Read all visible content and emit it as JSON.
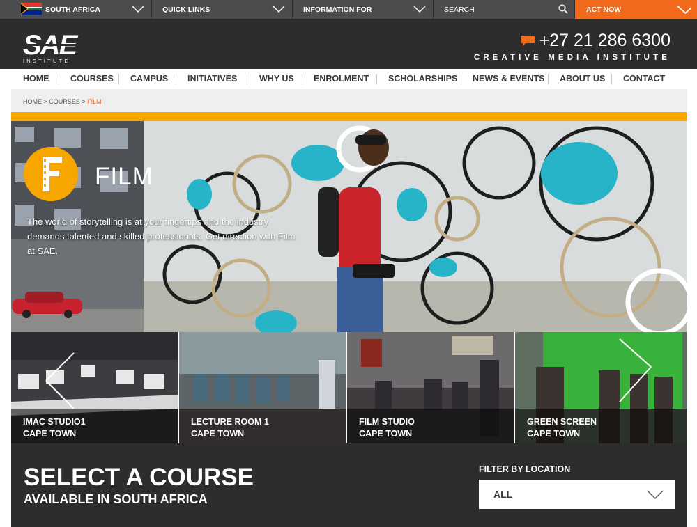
{
  "topbar": {
    "country": "SOUTH AFRICA",
    "quick_links": "QUICK LINKS",
    "information_for": "INFORMATION FOR",
    "search_placeholder": "SEARCH",
    "act_now": "ACT NOW"
  },
  "header": {
    "logo_text": "SAE",
    "logo_sub": "INSTITUTE",
    "phone": "+27 21 286 6300",
    "tagline": "CREATIVE MEDIA INSTITUTE"
  },
  "nav": {
    "items": [
      "HOME",
      "COURSES",
      "CAMPUS",
      "INITIATIVES",
      "WHY US",
      "ENROLMENT",
      "SCHOLARSHIPS",
      "NEWS & EVENTS",
      "ABOUT US",
      "CONTACT"
    ]
  },
  "breadcrumb": {
    "home": "HOME",
    "courses": "COURSES",
    "separator": ">",
    "current": "FILM"
  },
  "hero": {
    "badge_letter": "F",
    "title": "FILM",
    "description": "The world of storytelling is at your fingertips and the industry demands talented and skilled professionals. Get direction with Film at SAE."
  },
  "tiles": [
    {
      "line1": "IMAC STUDIO1",
      "line2": "CAPE TOWN"
    },
    {
      "line1": "LECTURE ROOM 1",
      "line2": "CAPE TOWN"
    },
    {
      "line1": "FILM STUDIO",
      "line2": "CAPE TOWN"
    },
    {
      "line1": "GREEN SCREEN",
      "line2": "CAPE TOWN"
    }
  ],
  "select": {
    "title": "SELECT A COURSE",
    "subtitle": "AVAILABLE IN SOUTH AFRICA",
    "filter_label": "FILTER BY LOCATION",
    "filter_value": "ALL"
  },
  "colors": {
    "accent_orange": "#f26b1d",
    "accent_yellow": "#f7a600",
    "dark_bg": "#2d2d2e",
    "topbar_bg": "#4a4c4e"
  }
}
